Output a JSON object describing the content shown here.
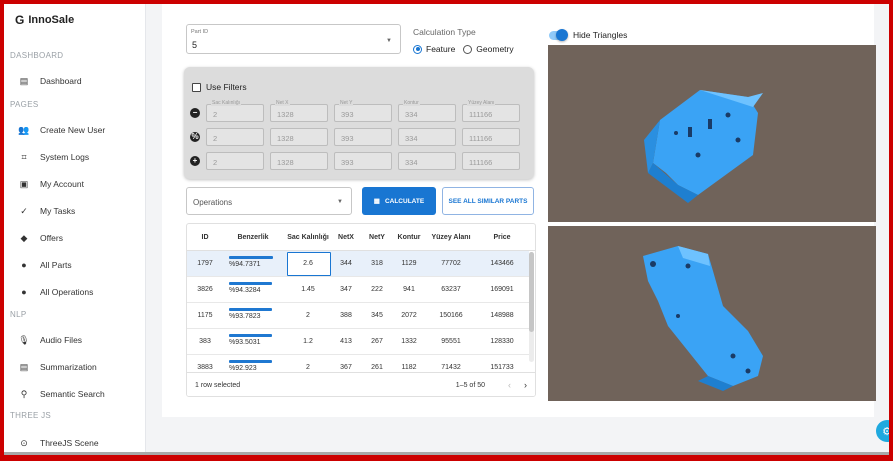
{
  "brand": {
    "logo": "G",
    "name": "InnoSale"
  },
  "sidebar": {
    "sections": [
      {
        "title": "DASHBOARD",
        "items": [
          {
            "label": "Dashboard",
            "icon": "calendar-icon",
            "glyph": "▤"
          }
        ]
      },
      {
        "title": "PAGES",
        "items": [
          {
            "label": "Create New User",
            "icon": "add-user-icon",
            "glyph": "👥"
          },
          {
            "label": "System Logs",
            "icon": "logs-icon",
            "glyph": "⌗"
          },
          {
            "label": "My Account",
            "icon": "account-icon",
            "glyph": "▣"
          },
          {
            "label": "My Tasks",
            "icon": "tasks-icon",
            "glyph": "✓"
          },
          {
            "label": "Offers",
            "icon": "tag-icon",
            "glyph": "◆"
          },
          {
            "label": "All Parts",
            "icon": "parts-icon",
            "glyph": "●"
          },
          {
            "label": "All Operations",
            "icon": "operations-icon",
            "glyph": "●"
          }
        ]
      },
      {
        "title": "NLP",
        "items": [
          {
            "label": "Audio Files",
            "icon": "microphone-icon",
            "glyph": "🎙"
          },
          {
            "label": "Summarization",
            "icon": "document-icon",
            "glyph": "▤"
          },
          {
            "label": "Semantic Search",
            "icon": "search-icon",
            "glyph": "⚲"
          }
        ]
      },
      {
        "title": "THREE JS",
        "items": [
          {
            "label": "ThreeJS Scene",
            "icon": "scene-icon",
            "glyph": "⊙"
          }
        ]
      }
    ]
  },
  "part_id": {
    "label": "Part ID",
    "value": "5"
  },
  "calc_type": {
    "title": "Calculation Type",
    "options": [
      "Feature",
      "Geometry"
    ],
    "selected": "Feature"
  },
  "filters": {
    "use_label": "Use Filters",
    "field_labels": [
      "Sac Kalınlığı",
      "Net X",
      "Net Y",
      "Kontur",
      "Yüzey Alanı"
    ],
    "rows": [
      {
        "op": "−",
        "values": [
          "2",
          "1328",
          "393",
          "334",
          "111166"
        ]
      },
      {
        "op": "%",
        "values": [
          "2",
          "1328",
          "393",
          "334",
          "111166"
        ]
      },
      {
        "op": "+",
        "values": [
          "2",
          "1328",
          "393",
          "334",
          "111166"
        ]
      }
    ]
  },
  "operations": {
    "placeholder": "Operations"
  },
  "buttons": {
    "calculate": "CALCULATE",
    "similar": "SEE ALL SIMILAR PARTS"
  },
  "table": {
    "columns": [
      "ID",
      "Benzerlik",
      "Sac Kalınlığı",
      "NetX",
      "NetY",
      "Kontur",
      "Yüzey Alanı",
      "Price"
    ],
    "rows": [
      {
        "id": "1797",
        "benzerlik": "%94.7371",
        "sim": 0.947,
        "sac": "2.6",
        "netx": "344",
        "nety": "318",
        "kontur": "1129",
        "yuzey": "77702",
        "price": "143466"
      },
      {
        "id": "3826",
        "benzerlik": "%94.3284",
        "sim": 0.943,
        "sac": "1.45",
        "netx": "347",
        "nety": "222",
        "kontur": "941",
        "yuzey": "63237",
        "price": "169091"
      },
      {
        "id": "1175",
        "benzerlik": "%93.7823",
        "sim": 0.938,
        "sac": "2",
        "netx": "388",
        "nety": "345",
        "kontur": "2072",
        "yuzey": "150166",
        "price": "148988"
      },
      {
        "id": "383",
        "benzerlik": "%93.5031",
        "sim": 0.935,
        "sac": "1.2",
        "netx": "413",
        "nety": "267",
        "kontur": "1332",
        "yuzey": "95551",
        "price": "128330"
      },
      {
        "id": "3883",
        "benzerlik": "%92.923",
        "sim": 0.929,
        "sac": "2",
        "netx": "367",
        "nety": "261",
        "kontur": "1182",
        "yuzey": "71432",
        "price": "151733"
      }
    ],
    "footer_selected": "1 row selected",
    "pagination": "1–5 of 50"
  },
  "viewer": {
    "toggle_label": "Hide Triangles",
    "bg_color": "#70635a",
    "part_color": "#3aa3f5"
  }
}
